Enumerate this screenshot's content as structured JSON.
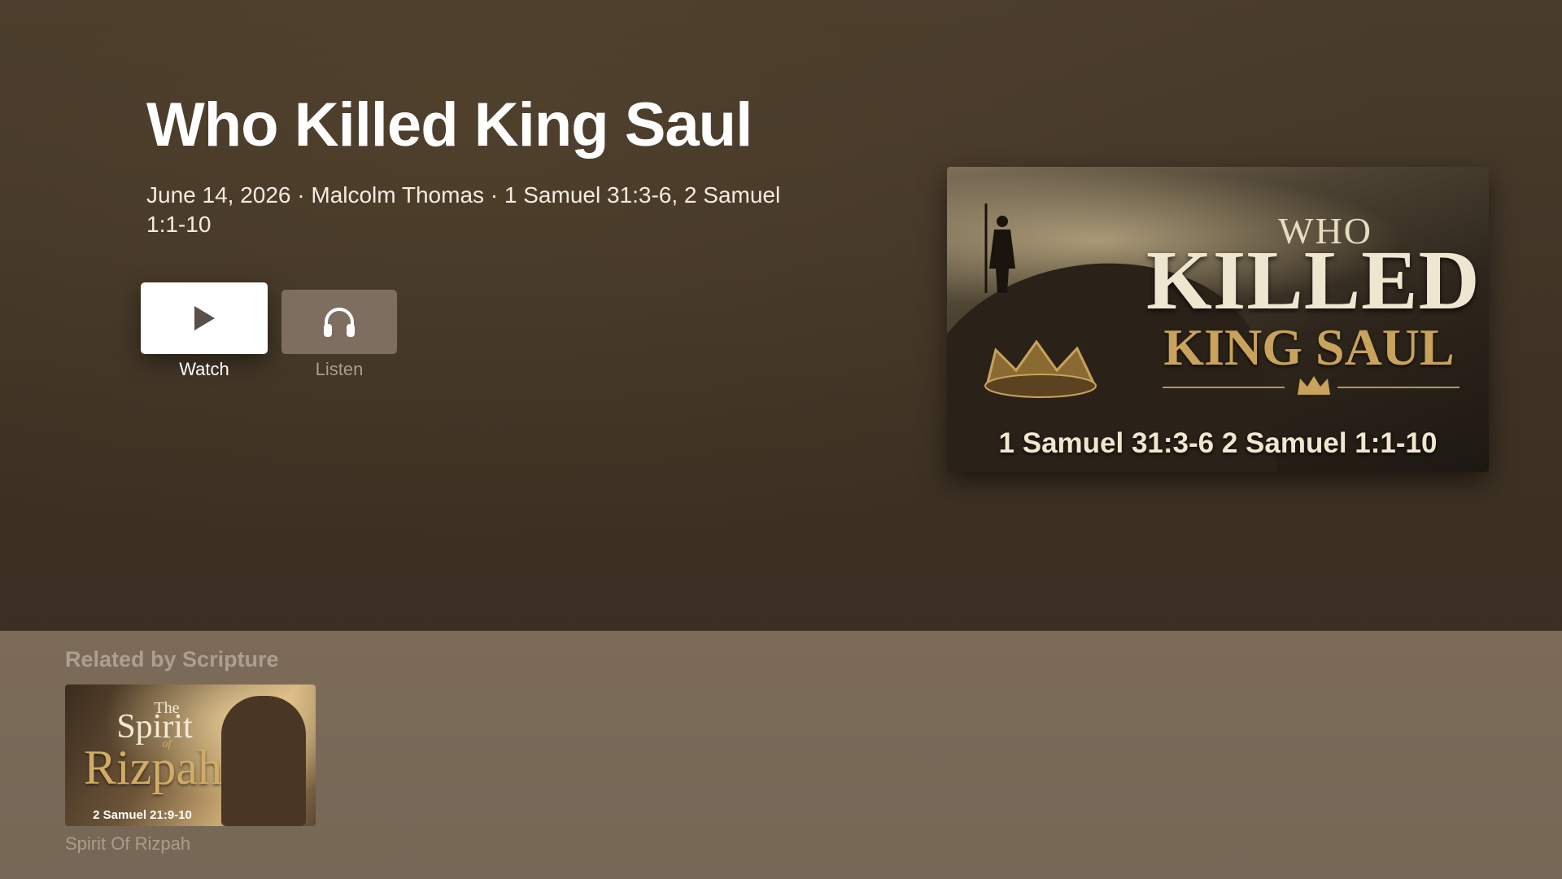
{
  "sermon": {
    "title": "Who Killed King Saul",
    "meta": "June 14, 2026 · Malcolm Thomas · 1 Samuel 31:3-6, 2 Samuel 1:1-10"
  },
  "actions": {
    "watch": {
      "label": "Watch",
      "icon": "play-icon"
    },
    "listen": {
      "label": "Listen",
      "icon": "headphones-icon"
    }
  },
  "artwork": {
    "who": "WHO",
    "killed": "KILLED",
    "king_saul": "KING SAUL",
    "scripture": "1 Samuel 31:3-6  2 Samuel 1:1-10"
  },
  "related": {
    "heading": "Related by Scripture",
    "items": [
      {
        "caption": "Spirit Of Rizpah",
        "art": {
          "the": "The",
          "spirit": "Spirit",
          "of": "of",
          "rizpah": "Rizpah",
          "scripture": "2 Samuel 21:9-10"
        }
      }
    ]
  },
  "colors": {
    "background_top": "#4a3c2c",
    "related_band": "#7c6b59",
    "watch_button": "#ffffff",
    "listen_button": "#7e6e60",
    "gold_accent": "#c9a25c"
  }
}
